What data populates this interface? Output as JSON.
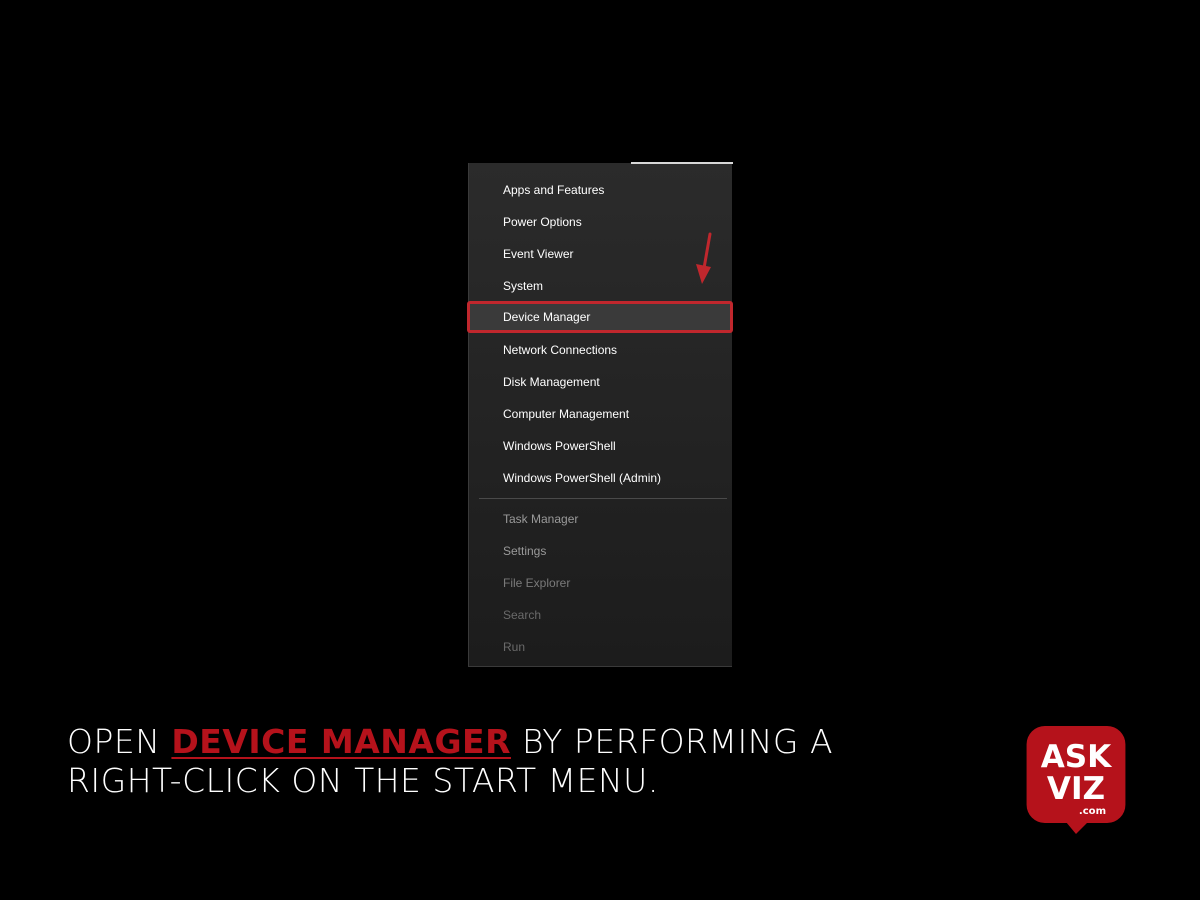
{
  "context_menu": {
    "items": [
      {
        "label": "Apps and Features",
        "group": "primary"
      },
      {
        "label": "Power Options",
        "group": "primary"
      },
      {
        "label": "Event Viewer",
        "group": "primary"
      },
      {
        "label": "System",
        "group": "primary"
      },
      {
        "label": "Device Manager",
        "group": "primary",
        "highlighted": true
      },
      {
        "label": "Network Connections",
        "group": "primary"
      },
      {
        "label": "Disk Management",
        "group": "primary"
      },
      {
        "label": "Computer Management",
        "group": "primary"
      },
      {
        "label": "Windows PowerShell",
        "group": "primary"
      },
      {
        "label": "Windows PowerShell (Admin)",
        "group": "primary"
      },
      {
        "label": "Task Manager",
        "group": "secondary"
      },
      {
        "label": "Settings",
        "group": "secondary"
      },
      {
        "label": "File Explorer",
        "group": "secondary"
      },
      {
        "label": "Search",
        "group": "secondary"
      },
      {
        "label": "Run",
        "group": "secondary"
      }
    ],
    "highlight_color": "#c0272d"
  },
  "caption": {
    "prefix": "OPEN ",
    "accent": "DEVICE MANAGER",
    "suffix_line1": " BY PERFORMING A",
    "line2": "RIGHT-CLICK ON THE START MENU.",
    "accent_color": "#b5121b"
  },
  "logo": {
    "line1": "ASK",
    "line2": "VIZ",
    "domain": ".com",
    "color": "#b5121b"
  }
}
